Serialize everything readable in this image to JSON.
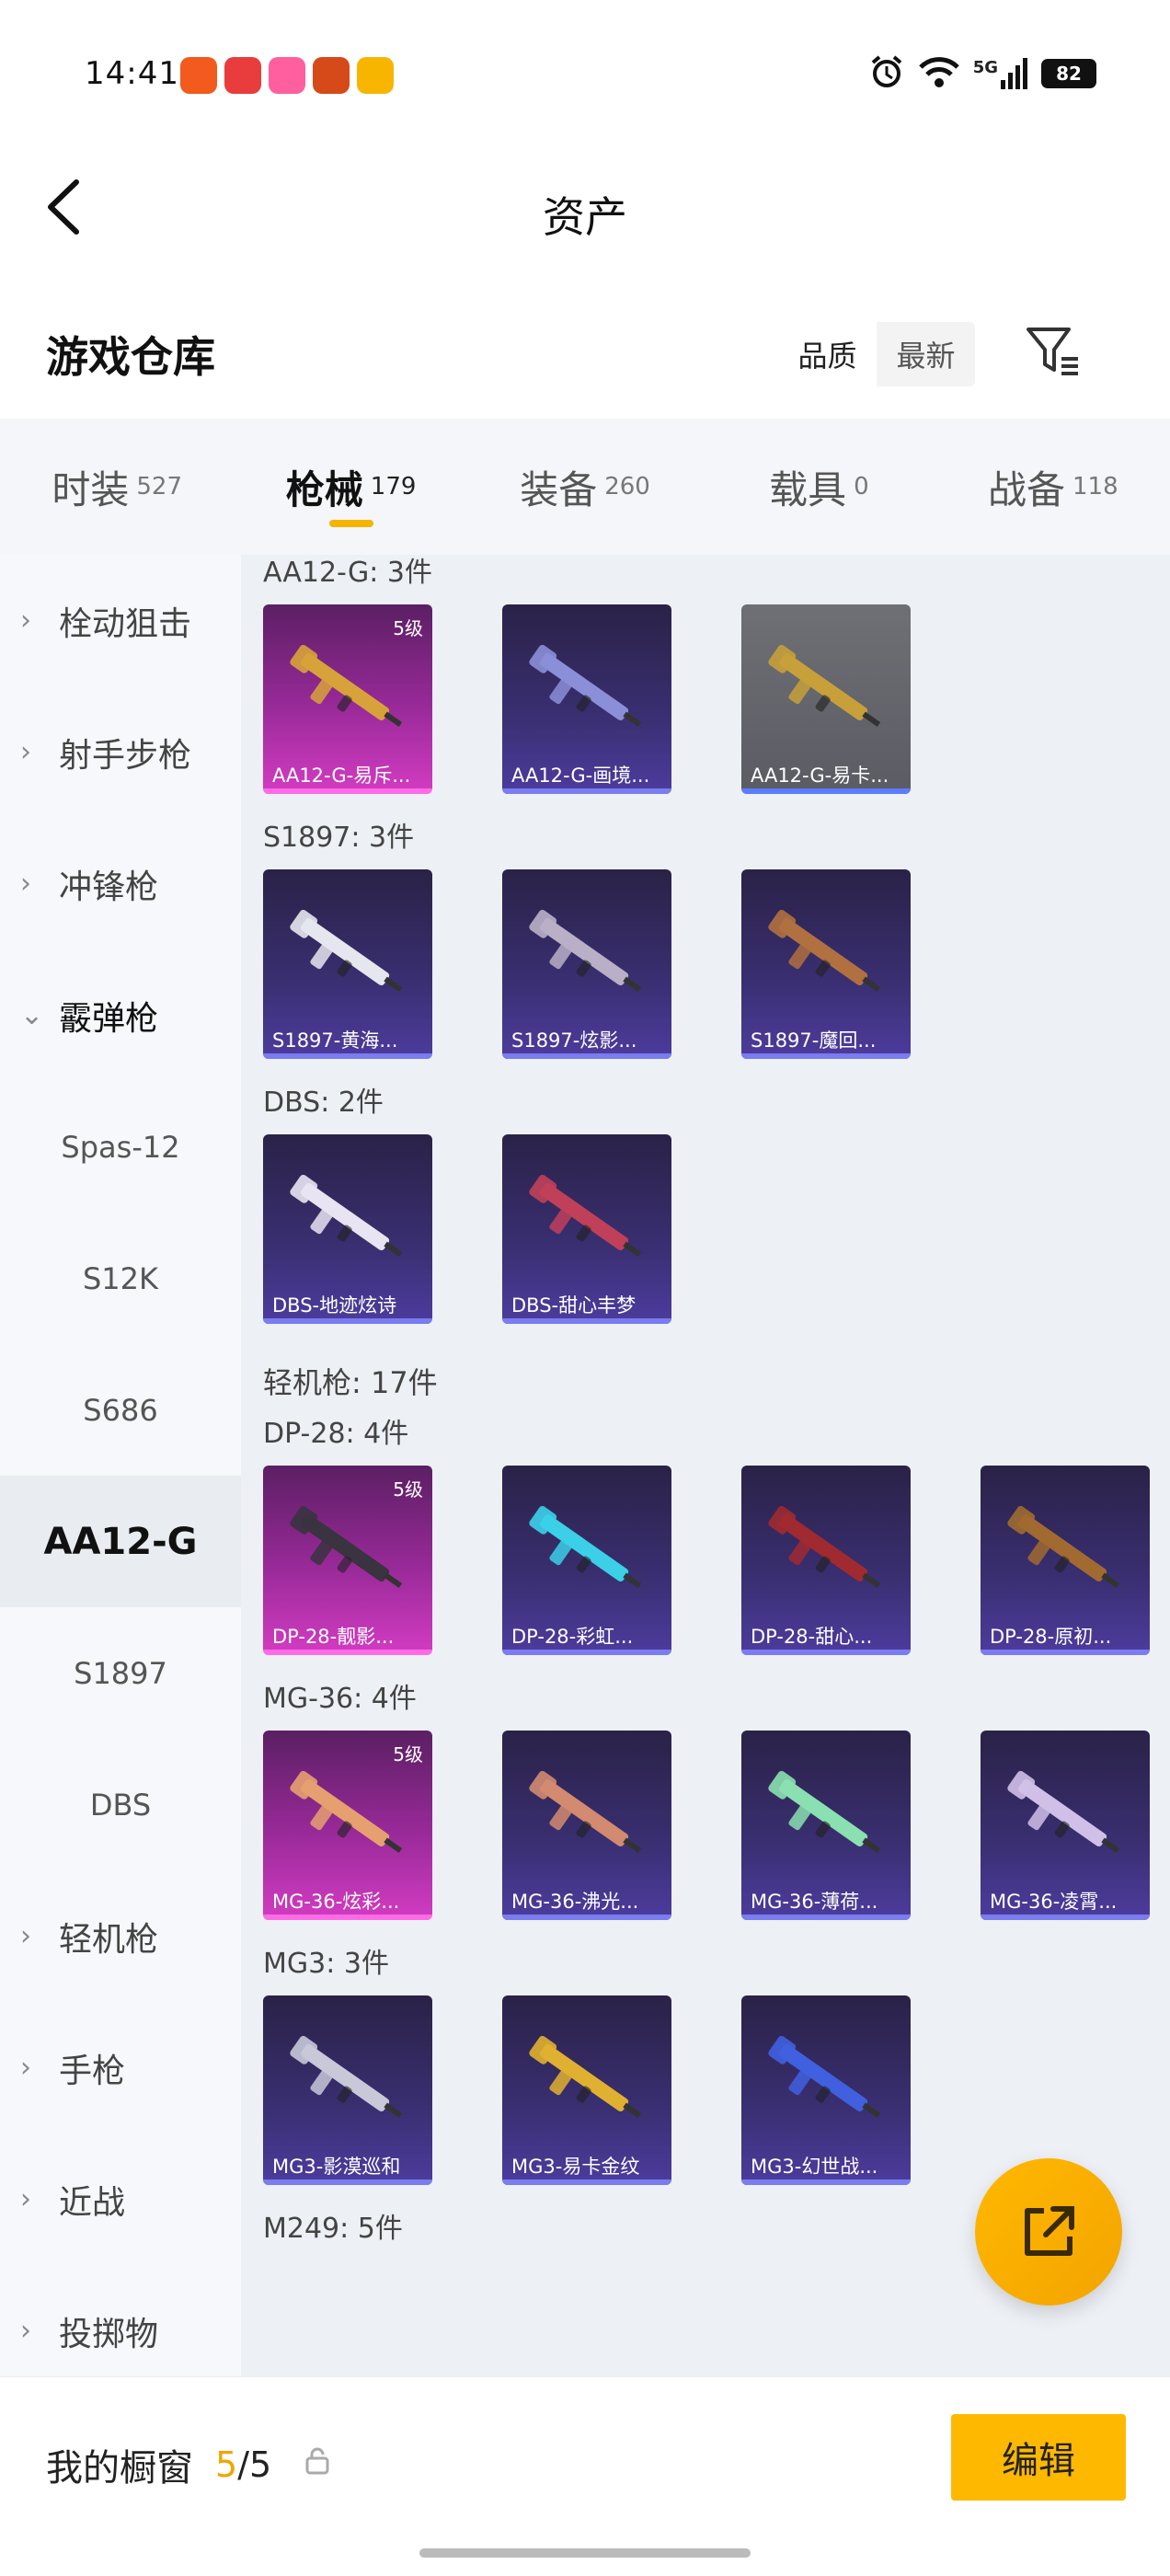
{
  "status": {
    "time": "14:41",
    "battery": "82",
    "network": "5G",
    "apps": [
      {
        "name": "app-icon-1",
        "color": "#f25a1e"
      },
      {
        "name": "app-icon-2",
        "color": "#e93d3d"
      },
      {
        "name": "app-icon-3",
        "color": "#ff5f9e"
      },
      {
        "name": "app-icon-4",
        "color": "#d64a1a"
      },
      {
        "name": "app-icon-5",
        "color": "#f7b500"
      }
    ]
  },
  "header": {
    "title": "资产"
  },
  "warehouse": {
    "title": "游戏仓库",
    "sort_options": [
      "品质",
      "最新"
    ],
    "sort_active": 0
  },
  "tabs": [
    {
      "label": "时装",
      "count": "527"
    },
    {
      "label": "枪械",
      "count": "179"
    },
    {
      "label": "装备",
      "count": "260"
    },
    {
      "label": "载具",
      "count": "0"
    },
    {
      "label": "战备",
      "count": "118"
    }
  ],
  "sidebar": {
    "items": [
      {
        "label": "栓动狙击",
        "type": "cat"
      },
      {
        "label": "射手步枪",
        "type": "cat"
      },
      {
        "label": "冲锋枪",
        "type": "cat"
      },
      {
        "label": "霰弹枪",
        "type": "open"
      },
      {
        "label": "Spas-12",
        "type": "sub"
      },
      {
        "label": "S12K",
        "type": "sub"
      },
      {
        "label": "S686",
        "type": "sub"
      },
      {
        "label": "AA12-G",
        "type": "sel"
      },
      {
        "label": "S1897",
        "type": "sub"
      },
      {
        "label": "DBS",
        "type": "sub"
      },
      {
        "label": "轻机枪",
        "type": "cat"
      },
      {
        "label": "手枪",
        "type": "cat"
      },
      {
        "label": "近战",
        "type": "cat"
      },
      {
        "label": "投掷物",
        "type": "cat"
      }
    ]
  },
  "groups": [
    {
      "title": "AA12-G: 3件",
      "cards": [
        {
          "name": "AA12-G-易斥...",
          "style": "pink",
          "level": "5级",
          "gun": "#d8a23a"
        },
        {
          "name": "AA12-G-画境...",
          "style": "purple",
          "level": "",
          "gun": "#8b8fd8"
        },
        {
          "name": "AA12-G-易卡...",
          "style": "gray",
          "level": "",
          "gun": "#c7a03a"
        }
      ]
    },
    {
      "title": "S1897: 3件",
      "cards": [
        {
          "name": "S1897-黄海...",
          "style": "purple",
          "level": "",
          "gun": "#e6e6ee"
        },
        {
          "name": "S1897-炫影...",
          "style": "purple",
          "level": "",
          "gun": "#b9b0c8"
        },
        {
          "name": "S1897-魔回...",
          "style": "purple",
          "level": "",
          "gun": "#b07040"
        }
      ]
    },
    {
      "title": "DBS: 2件",
      "cards": [
        {
          "name": "DBS-地迹炫诗",
          "style": "purple",
          "level": "",
          "gun": "#e8e4f2"
        },
        {
          "name": "DBS-甜心丰梦",
          "style": "purple",
          "level": "",
          "gun": "#c0405a"
        }
      ]
    },
    {
      "title": "轻机枪: 17件",
      "category": true,
      "cards": []
    },
    {
      "title": "DP-28: 4件",
      "cards": [
        {
          "name": "DP-28-靓影...",
          "style": "pink",
          "level": "5级",
          "gun": "#3a3340"
        },
        {
          "name": "DP-28-彩虹...",
          "style": "purple",
          "level": "",
          "gun": "#3bd0e8"
        },
        {
          "name": "DP-28-甜心...",
          "style": "purple",
          "level": "",
          "gun": "#a02a30"
        },
        {
          "name": "DP-28-原初...",
          "style": "purple",
          "level": "",
          "gun": "#a06a30"
        }
      ]
    },
    {
      "title": "MG-36: 4件",
      "cards": [
        {
          "name": "MG-36-炫彩...",
          "style": "pink",
          "level": "5级",
          "gun": "#e6a070"
        },
        {
          "name": "MG-36-沸光...",
          "style": "purple",
          "level": "",
          "gun": "#d28a70"
        },
        {
          "name": "MG-36-薄荷...",
          "style": "purple",
          "level": "",
          "gun": "#8ae0b0"
        },
        {
          "name": "MG-36-凌霄...",
          "style": "purple",
          "level": "",
          "gun": "#d0c0e8"
        }
      ]
    },
    {
      "title": "MG3: 3件",
      "cards": [
        {
          "name": "MG3-影漠巡和",
          "style": "purple",
          "level": "",
          "gun": "#c8c8d8"
        },
        {
          "name": "MG3-易卡金纹",
          "style": "purple",
          "level": "",
          "gun": "#e0b030"
        },
        {
          "name": "MG3-幻世战...",
          "style": "purple",
          "level": "",
          "gun": "#4060e0"
        }
      ]
    },
    {
      "title": "M249: 5件",
      "cards": []
    }
  ],
  "bottom": {
    "label": "我的橱窗",
    "count_current": "5",
    "count_total": "/5",
    "edit_label": "编辑"
  }
}
